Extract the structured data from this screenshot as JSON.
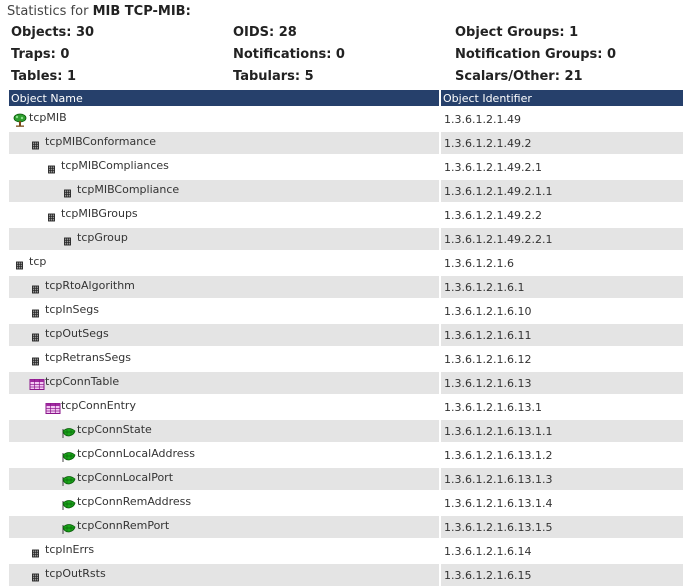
{
  "title": {
    "prefix": "Statistics for ",
    "mib": "MIB TCP-MIB:"
  },
  "stats": [
    [
      "Objects: 30",
      "OIDS: 28",
      "Object Groups: 1"
    ],
    [
      "Traps: 0",
      "Notifications: 0",
      "Notification Groups: 0"
    ],
    [
      "Tables: 1",
      "Tabulars: 5",
      "Scalars/Other: 21"
    ]
  ],
  "table": {
    "col_name": "Object Name",
    "col_oid": "Object Identifier",
    "rows": [
      {
        "name": "tcpMIB",
        "oid": "1.3.6.1.2.1.49",
        "depth": 0,
        "icon": "tree-icon"
      },
      {
        "name": "tcpMIBConformance",
        "oid": "1.3.6.1.2.1.49.2",
        "depth": 1,
        "icon": "node-icon"
      },
      {
        "name": "tcpMIBCompliances",
        "oid": "1.3.6.1.2.1.49.2.1",
        "depth": 2,
        "icon": "node-icon"
      },
      {
        "name": "tcpMIBCompliance",
        "oid": "1.3.6.1.2.1.49.2.1.1",
        "depth": 3,
        "icon": "node-icon"
      },
      {
        "name": "tcpMIBGroups",
        "oid": "1.3.6.1.2.1.49.2.2",
        "depth": 2,
        "icon": "node-icon"
      },
      {
        "name": "tcpGroup",
        "oid": "1.3.6.1.2.1.49.2.2.1",
        "depth": 3,
        "icon": "node-icon"
      },
      {
        "name": "tcp",
        "oid": "1.3.6.1.2.1.6",
        "depth": 0,
        "icon": "node-icon"
      },
      {
        "name": "tcpRtoAlgorithm",
        "oid": "1.3.6.1.2.1.6.1",
        "depth": 1,
        "icon": "node-icon"
      },
      {
        "name": "tcpInSegs",
        "oid": "1.3.6.1.2.1.6.10",
        "depth": 1,
        "icon": "node-icon"
      },
      {
        "name": "tcpOutSegs",
        "oid": "1.3.6.1.2.1.6.11",
        "depth": 1,
        "icon": "node-icon"
      },
      {
        "name": "tcpRetransSegs",
        "oid": "1.3.6.1.2.1.6.12",
        "depth": 1,
        "icon": "node-icon"
      },
      {
        "name": "tcpConnTable",
        "oid": "1.3.6.1.2.1.6.13",
        "depth": 1,
        "icon": "table-icon"
      },
      {
        "name": "tcpConnEntry",
        "oid": "1.3.6.1.2.1.6.13.1",
        "depth": 2,
        "icon": "table-icon"
      },
      {
        "name": "tcpConnState",
        "oid": "1.3.6.1.2.1.6.13.1.1",
        "depth": 3,
        "icon": "leaf-icon"
      },
      {
        "name": "tcpConnLocalAddress",
        "oid": "1.3.6.1.2.1.6.13.1.2",
        "depth": 3,
        "icon": "leaf-icon"
      },
      {
        "name": "tcpConnLocalPort",
        "oid": "1.3.6.1.2.1.6.13.1.3",
        "depth": 3,
        "icon": "leaf-icon"
      },
      {
        "name": "tcpConnRemAddress",
        "oid": "1.3.6.1.2.1.6.13.1.4",
        "depth": 3,
        "icon": "leaf-icon"
      },
      {
        "name": "tcpConnRemPort",
        "oid": "1.3.6.1.2.1.6.13.1.5",
        "depth": 3,
        "icon": "leaf-icon"
      },
      {
        "name": "tcpInErrs",
        "oid": "1.3.6.1.2.1.6.14",
        "depth": 1,
        "icon": "node-icon"
      },
      {
        "name": "tcpOutRsts",
        "oid": "1.3.6.1.2.1.6.15",
        "depth": 1,
        "icon": "node-icon"
      }
    ]
  },
  "colors": {
    "header_bg": "#26406b",
    "row_shade": "#e4e4e4",
    "leaf_green": "#1aa51a",
    "table_purple": "#a02aa0"
  }
}
